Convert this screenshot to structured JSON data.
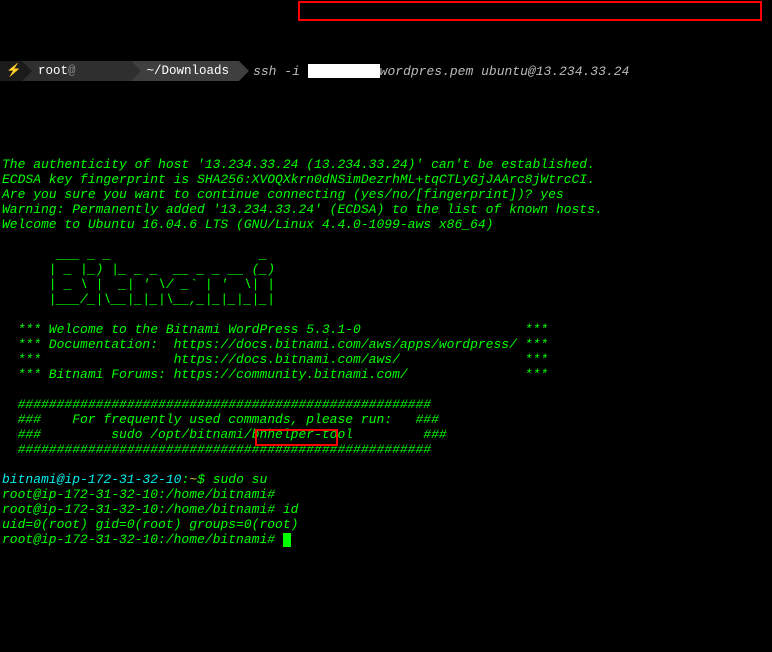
{
  "top": {
    "lightning": "⚡",
    "seg1_user": "root",
    "seg1_at": "@",
    "seg1_host_redacted": "      ",
    "seg2_path": "~/Downloads",
    "cmd_pre": "ssh -i ",
    "cmd_post": "wordpres.pem ubuntu@13.234.33.24"
  },
  "lines": {
    "l1": "The authenticity of host '13.234.33.24 (13.234.33.24)' can't be established.",
    "l2": "ECDSA key fingerprint is SHA256:XVOQXkrn0dNSimDezrhML+tqCTLyGjJAArc8jWtrcCI.",
    "l3a": "Are you sure you want to continue connecting (yes/no/[fingerprint])? ",
    "l3b": "yes",
    "l4": "Warning: Permanently added '13.234.33.24' (ECDSA) to the list of known hosts.",
    "l5": "Welcome to Ubuntu 16.04.6 LTS (GNU/Linux 4.4.0-1099-aws x86_64)"
  },
  "ascii": {
    "a1": "       ___ _ _                   _",
    "a2": "      | _ |_) |_ _ _  __ _ _ __ (_)",
    "a3": "      | _ \\ |  _| ' \\/ _` | '  \\| |",
    "a4": "      |___/_|\\__|_|_|\\__,_|_|_|_|_|"
  },
  "banner": {
    "b1": "  *** Welcome to the Bitnami WordPress 5.3.1-0                     ***",
    "b2": "  *** Documentation:  https://docs.bitnami.com/aws/apps/wordpress/ ***",
    "b3": "  ***                 https://docs.bitnami.com/aws/                ***",
    "b4": "  *** Bitnami Forums: https://community.bitnami.com/               ***",
    "h1": "  #####################################################",
    "h2": "  ###    For frequently used commands, please run:   ###",
    "h3": "  ###         sudo /opt/bitnami/bnhelper-tool         ###",
    "h4": "  #####################################################"
  },
  "shell": {
    "p1_user": "bitnami@ip-172-31-32-10",
    "p1_colon": ":",
    "p1_path": "~",
    "p1_dollar": "$ ",
    "p1_cmd": "sudo su ",
    "p2": "root@ip-172-31-32-10:/home/bitnami#",
    "p3": "root@ip-172-31-32-10:/home/bitnami# ",
    "p3_cmd": "id",
    "p4": "uid=0(root) gid=0(root) groups=0(root)",
    "p5": "root@ip-172-31-32-10:/home/bitnami# "
  }
}
